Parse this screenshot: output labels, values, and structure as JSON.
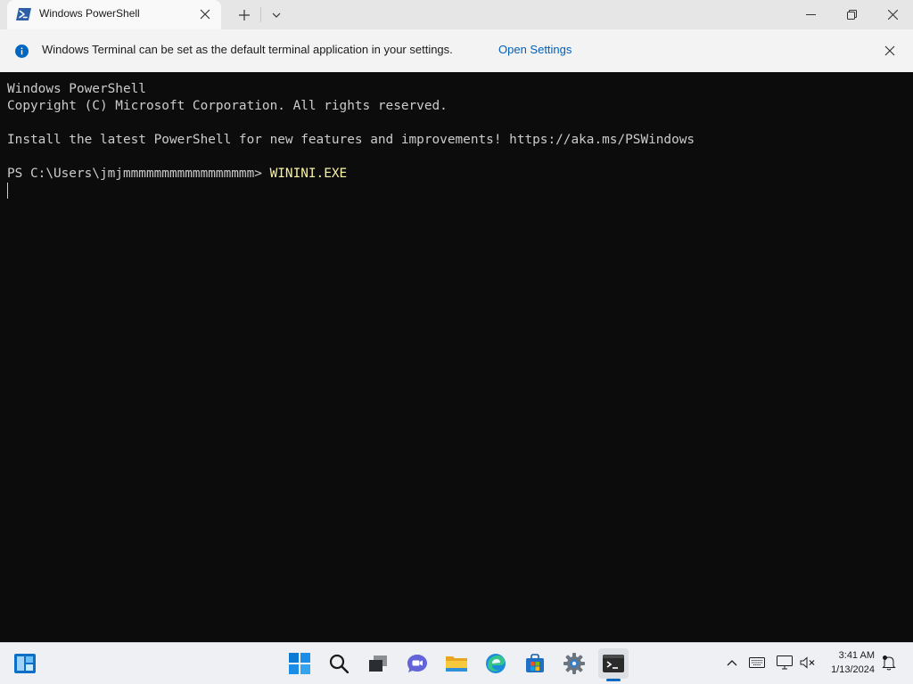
{
  "window": {
    "tab_title": "Windows PowerShell",
    "tab_icon": "powershell-icon",
    "controls": [
      "new-tab-icon",
      "dropdown-chevron-icon",
      "minimize-icon",
      "maximize-icon",
      "close-icon"
    ]
  },
  "infobar": {
    "message": "Windows Terminal can be set as the default terminal application in your settings.",
    "link": "Open Settings",
    "icon": "info-icon",
    "colors": {
      "link": "#005fb8",
      "icon": "#0067c0"
    }
  },
  "console": {
    "lines": [
      "Windows PowerShell",
      "Copyright (C) Microsoft Corporation. All rights reserved.",
      "",
      "Install the latest PowerShell for new features and improvements! https://aka.ms/PSWindows",
      ""
    ],
    "prompt": "PS C:\\Users\\jmjmmmmmmmmmmmmmmmmm> ",
    "command": "WININI.EXE",
    "colors": {
      "background": "#0c0c0c",
      "text": "#cccccc",
      "command": "#f9f1a5"
    }
  },
  "taskbar": {
    "left": [
      "widgets-icon"
    ],
    "apps": [
      "start-icon",
      "search-icon",
      "task-view-icon",
      "chat-icon",
      "file-explorer-icon",
      "edge-icon",
      "store-icon",
      "settings-icon",
      "terminal-icon"
    ],
    "active_app": "terminal-icon",
    "tray": [
      "chevron-up-icon",
      "keyboard-icon",
      "display-icon",
      "volume-muted-icon"
    ],
    "clock": {
      "time": "3:41 AM",
      "date": "1/13/2024"
    },
    "notification": "notification-icon"
  }
}
